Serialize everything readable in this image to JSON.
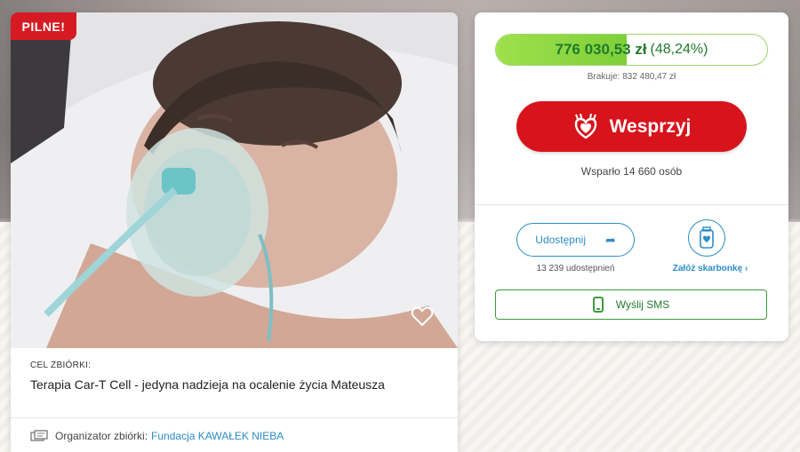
{
  "campaign": {
    "badge": "PILNE!",
    "goal_label": "CEL ZBIÓRKI:",
    "goal_title": "Terapia Car-T Cell - jedyna nadzieja na ocalenie życia Mateusza",
    "organizer_label": "Organizator zbiórki:",
    "organizer_name": "Fundacja KAWAŁEK NIEBA"
  },
  "progress": {
    "amount": "776 030,53 zł",
    "percent_label": "(48,24%)",
    "fraction": 0.4824,
    "missing": "Brakuje: 832 480,47 zł"
  },
  "donate": {
    "label": "Wesprzyj",
    "supporters": "Wsparło 14 660 osób"
  },
  "share": {
    "label": "Udostępnij",
    "count": "13 239 udostępnień"
  },
  "piggybank": {
    "label": "Załóż skarbonkę ›"
  },
  "sms": {
    "label": "Wyślij SMS"
  },
  "colors": {
    "urgent": "#d61a23",
    "donate": "#d7141c",
    "progress": "#8fd743",
    "link": "#2c8dc7",
    "green_text": "#1f7b2c"
  },
  "icons": {
    "favorite": "heart-outline-icon",
    "share": "share-arrow-icon",
    "piggybank": "piggybank-jar-icon",
    "sms": "phone-icon",
    "organizer": "organizer-icon",
    "donate": "hands-heart-icon"
  }
}
